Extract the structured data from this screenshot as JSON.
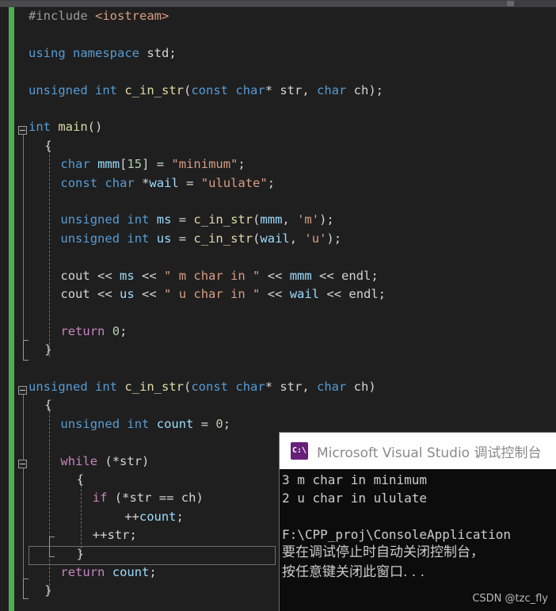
{
  "window": {
    "title": "Visual Studio C++ editor with debug console"
  },
  "scrollbar": {
    "name": "horizontal-scrollbar"
  },
  "editor": {
    "language": "C++",
    "theme": "dark",
    "lines": [
      {
        "n": 1,
        "indent": 0,
        "tokens": [
          {
            "t": "#include ",
            "c": "pp"
          },
          {
            "t": "<iostream>",
            "c": "str"
          }
        ]
      },
      {
        "n": 2,
        "indent": 0,
        "tokens": []
      },
      {
        "n": 3,
        "indent": 0,
        "tokens": [
          {
            "t": "using",
            "c": "kw"
          },
          {
            "t": " ",
            "c": "pl"
          },
          {
            "t": "namespace",
            "c": "kw"
          },
          {
            "t": " std",
            "c": "pl"
          },
          {
            "t": ";",
            "c": "pl"
          }
        ]
      },
      {
        "n": 4,
        "indent": 0,
        "tokens": []
      },
      {
        "n": 5,
        "indent": 0,
        "tokens": [
          {
            "t": "unsigned",
            "c": "kw"
          },
          {
            "t": " ",
            "c": "pl"
          },
          {
            "t": "int",
            "c": "kw"
          },
          {
            "t": " ",
            "c": "pl"
          },
          {
            "t": "c_in_str",
            "c": "fn"
          },
          {
            "t": "(",
            "c": "pl"
          },
          {
            "t": "const",
            "c": "kw"
          },
          {
            "t": " ",
            "c": "pl"
          },
          {
            "t": "char",
            "c": "kw"
          },
          {
            "t": "* str, ",
            "c": "pl"
          },
          {
            "t": "char",
            "c": "kw"
          },
          {
            "t": " ch);",
            "c": "pl"
          }
        ]
      },
      {
        "n": 6,
        "indent": 0,
        "tokens": []
      },
      {
        "n": 7,
        "indent": 0,
        "tokens": [
          {
            "t": "int",
            "c": "kw"
          },
          {
            "t": " ",
            "c": "pl"
          },
          {
            "t": "main",
            "c": "fn"
          },
          {
            "t": "()",
            "c": "pl"
          }
        ]
      },
      {
        "n": 8,
        "indent": 1,
        "tokens": [
          {
            "t": "{",
            "c": "pl"
          }
        ]
      },
      {
        "n": 9,
        "indent": 2,
        "tokens": [
          {
            "t": "char",
            "c": "kw"
          },
          {
            "t": " ",
            "c": "pl"
          },
          {
            "t": "mmm",
            "c": "var"
          },
          {
            "t": "[",
            "c": "pl"
          },
          {
            "t": "15",
            "c": "num"
          },
          {
            "t": "] = ",
            "c": "pl"
          },
          {
            "t": "\"minimum\"",
            "c": "str"
          },
          {
            "t": ";",
            "c": "pl"
          }
        ]
      },
      {
        "n": 10,
        "indent": 2,
        "tokens": [
          {
            "t": "const",
            "c": "kw"
          },
          {
            "t": " ",
            "c": "pl"
          },
          {
            "t": "char",
            "c": "kw"
          },
          {
            "t": " *",
            "c": "pl"
          },
          {
            "t": "wail",
            "c": "var"
          },
          {
            "t": " = ",
            "c": "pl"
          },
          {
            "t": "\"ululate\"",
            "c": "str"
          },
          {
            "t": ";",
            "c": "pl"
          }
        ]
      },
      {
        "n": 11,
        "indent": 2,
        "tokens": []
      },
      {
        "n": 12,
        "indent": 2,
        "tokens": [
          {
            "t": "unsigned",
            "c": "kw"
          },
          {
            "t": " ",
            "c": "pl"
          },
          {
            "t": "int",
            "c": "kw"
          },
          {
            "t": " ",
            "c": "pl"
          },
          {
            "t": "ms",
            "c": "var"
          },
          {
            "t": " = ",
            "c": "pl"
          },
          {
            "t": "c_in_str",
            "c": "fn"
          },
          {
            "t": "(",
            "c": "pl"
          },
          {
            "t": "mmm",
            "c": "var"
          },
          {
            "t": ", ",
            "c": "pl"
          },
          {
            "t": "'m'",
            "c": "str"
          },
          {
            "t": ");",
            "c": "pl"
          }
        ]
      },
      {
        "n": 13,
        "indent": 2,
        "tokens": [
          {
            "t": "unsigned",
            "c": "kw"
          },
          {
            "t": " ",
            "c": "pl"
          },
          {
            "t": "int",
            "c": "kw"
          },
          {
            "t": " ",
            "c": "pl"
          },
          {
            "t": "us",
            "c": "var"
          },
          {
            "t": " = ",
            "c": "pl"
          },
          {
            "t": "c_in_str",
            "c": "fn"
          },
          {
            "t": "(",
            "c": "pl"
          },
          {
            "t": "wail",
            "c": "var"
          },
          {
            "t": ", ",
            "c": "pl"
          },
          {
            "t": "'u'",
            "c": "str"
          },
          {
            "t": ");",
            "c": "pl"
          }
        ]
      },
      {
        "n": 14,
        "indent": 2,
        "tokens": []
      },
      {
        "n": 15,
        "indent": 2,
        "tokens": [
          {
            "t": "cout << ",
            "c": "pl"
          },
          {
            "t": "ms",
            "c": "var"
          },
          {
            "t": " << ",
            "c": "pl"
          },
          {
            "t": "\" m char in \"",
            "c": "str"
          },
          {
            "t": " << ",
            "c": "pl"
          },
          {
            "t": "mmm",
            "c": "var"
          },
          {
            "t": " << endl;",
            "c": "pl"
          }
        ]
      },
      {
        "n": 16,
        "indent": 2,
        "tokens": [
          {
            "t": "cout << ",
            "c": "pl"
          },
          {
            "t": "us",
            "c": "var"
          },
          {
            "t": " << ",
            "c": "pl"
          },
          {
            "t": "\" u char in \"",
            "c": "str"
          },
          {
            "t": " << ",
            "c": "pl"
          },
          {
            "t": "wail",
            "c": "var"
          },
          {
            "t": " << endl;",
            "c": "pl"
          }
        ]
      },
      {
        "n": 17,
        "indent": 2,
        "tokens": []
      },
      {
        "n": 18,
        "indent": 2,
        "tokens": [
          {
            "t": "return",
            "c": "ctl"
          },
          {
            "t": " ",
            "c": "pl"
          },
          {
            "t": "0",
            "c": "num"
          },
          {
            "t": ";",
            "c": "pl"
          }
        ]
      },
      {
        "n": 19,
        "indent": 1,
        "tokens": [
          {
            "t": "}",
            "c": "pl"
          }
        ]
      },
      {
        "n": 20,
        "indent": 0,
        "tokens": []
      },
      {
        "n": 21,
        "indent": 0,
        "tokens": [
          {
            "t": "unsigned",
            "c": "kw"
          },
          {
            "t": " ",
            "c": "pl"
          },
          {
            "t": "int",
            "c": "kw"
          },
          {
            "t": " ",
            "c": "pl"
          },
          {
            "t": "c_in_str",
            "c": "fn"
          },
          {
            "t": "(",
            "c": "pl"
          },
          {
            "t": "const",
            "c": "kw"
          },
          {
            "t": " ",
            "c": "pl"
          },
          {
            "t": "char",
            "c": "kw"
          },
          {
            "t": "* str, ",
            "c": "pl"
          },
          {
            "t": "char",
            "c": "kw"
          },
          {
            "t": " ch)",
            "c": "pl"
          }
        ]
      },
      {
        "n": 22,
        "indent": 1,
        "tokens": [
          {
            "t": "{",
            "c": "pl"
          }
        ]
      },
      {
        "n": 23,
        "indent": 2,
        "tokens": [
          {
            "t": "unsigned",
            "c": "kw"
          },
          {
            "t": " ",
            "c": "pl"
          },
          {
            "t": "int",
            "c": "kw"
          },
          {
            "t": " ",
            "c": "pl"
          },
          {
            "t": "count",
            "c": "var"
          },
          {
            "t": " = ",
            "c": "pl"
          },
          {
            "t": "0",
            "c": "num"
          },
          {
            "t": ";",
            "c": "pl"
          }
        ]
      },
      {
        "n": 24,
        "indent": 2,
        "tokens": []
      },
      {
        "n": 25,
        "indent": 2,
        "tokens": [
          {
            "t": "while",
            "c": "ctl"
          },
          {
            "t": " (*str)",
            "c": "pl"
          }
        ]
      },
      {
        "n": 26,
        "indent": 3,
        "tokens": [
          {
            "t": "{",
            "c": "pl"
          }
        ]
      },
      {
        "n": 27,
        "indent": 4,
        "tokens": [
          {
            "t": "if",
            "c": "ctl"
          },
          {
            "t": " (*str == ch)",
            "c": "pl"
          }
        ]
      },
      {
        "n": 28,
        "indent": 6,
        "tokens": [
          {
            "t": "++",
            "c": "pl"
          },
          {
            "t": "count",
            "c": "var"
          },
          {
            "t": ";",
            "c": "pl"
          }
        ]
      },
      {
        "n": 29,
        "indent": 4,
        "tokens": [
          {
            "t": "++str;",
            "c": "pl"
          }
        ]
      },
      {
        "n": 30,
        "indent": 3,
        "tokens": [
          {
            "t": "}",
            "c": "pl"
          }
        ]
      },
      {
        "n": 31,
        "indent": 2,
        "tokens": [
          {
            "t": "return",
            "c": "ctl"
          },
          {
            "t": " ",
            "c": "pl"
          },
          {
            "t": "count",
            "c": "var"
          },
          {
            "t": ";",
            "c": "pl"
          }
        ]
      },
      {
        "n": 32,
        "indent": 1,
        "tokens": [
          {
            "t": "}",
            "c": "pl"
          }
        ]
      }
    ],
    "current_line_number": 29,
    "fold_markers": [
      {
        "line": 7,
        "state": "expanded"
      },
      {
        "line": 21,
        "state": "expanded"
      },
      {
        "line": 25,
        "state": "expanded"
      }
    ],
    "colors": {
      "background": "#1f1f1f",
      "keyword": "#569cd6",
      "control": "#c586c0",
      "function": "#dcdcaa",
      "string": "#d69d85",
      "number": "#b5cea8",
      "variable": "#9cdcfe",
      "plain": "#d4d4d4",
      "change_bar": "#4caf50"
    }
  },
  "console": {
    "title": "Microsoft Visual Studio 调试控制台",
    "icon_glyph": "C:\\",
    "icon_name": "visual-studio-console-icon",
    "lines": [
      "3 m char in minimum",
      "2 u char in ululate",
      "",
      "F:\\CPP_proj\\ConsoleApplication",
      "要在调试停止时自动关闭控制台，",
      "按任意键关闭此窗口. . ."
    ],
    "background": "#0c0c0c",
    "text_color": "#cccccc"
  },
  "watermark": {
    "text": "CSDN @tzc_fly"
  }
}
